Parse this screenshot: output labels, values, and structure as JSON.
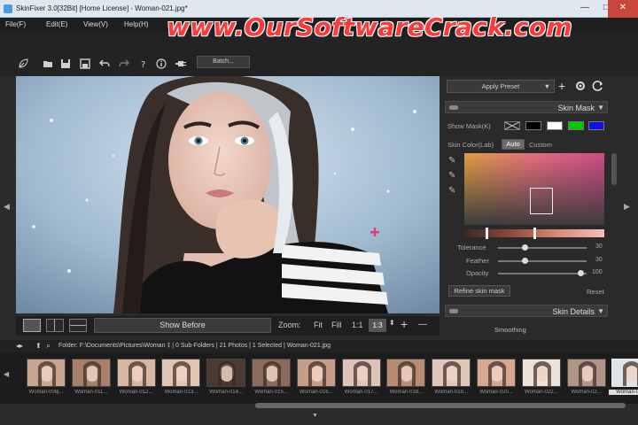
{
  "window": {
    "title": "SkinFixer 3.0[32Bit] [Home License] - Woman-021.jpg*",
    "controls": {
      "minimize": "—",
      "maximize": "□",
      "close": "✕"
    }
  },
  "watermark": "www.OurSoftwareCrack.com",
  "menu": {
    "file": "File(F)",
    "edit": "Edit(E)",
    "view": "View(V)",
    "help": "Help(H)"
  },
  "toolbar": {
    "batch_label": "Batch...",
    "icons": [
      "logo-leaf-icon",
      "open-icon",
      "save-icon",
      "save-as-icon",
      "undo-icon",
      "redo-icon",
      "help-icon",
      "info-icon",
      "plugin-icon"
    ]
  },
  "viewbar": {
    "show_before_label": "Show Before",
    "zoom_label": "Zoom:",
    "fit_label": "Fit",
    "fill_label": "Fill",
    "one_to_one_label": "1:1",
    "zoom_value": "1:3",
    "plus": "+",
    "minus": "—"
  },
  "panel": {
    "apply_preset_label": "Apply Preset",
    "skin_mask": {
      "header": "Skin Mask",
      "show_mask_label": "Show Mask(K)",
      "swatch_colors": [
        "#000000",
        "#ffffff",
        "#00c800",
        "#1010e0"
      ],
      "skin_color_label": "Skin Color(Lab)",
      "auto_label": "Auto",
      "custom_label": "Custom",
      "tolerance_label": "Tolerance",
      "tolerance_value": "30",
      "feather_label": "Feather",
      "feather_value": "30",
      "opacity_label": "Opacity",
      "opacity_value": "100",
      "tolerance_level": 0.3,
      "feather_level": 0.3,
      "opacity_level": 1.0,
      "refine_label": "Refine skin mask",
      "reset_label": "Reset"
    },
    "skin_details": {
      "header": "Skin Details",
      "smoothing_label": "Smoothing"
    }
  },
  "filmbar": {
    "folder_text": "Folder:  F:\\Documents\\Pictures\\Woman ‡ | 0 Sub-Folders | 21 Photos | 1 Selected | Woman-021.jpg"
  },
  "thumbnails": [
    {
      "label": "Woman-008j..."
    },
    {
      "label": "Woman-011..."
    },
    {
      "label": "Woman-012..."
    },
    {
      "label": "Woman-013..."
    },
    {
      "label": "Woman-014..."
    },
    {
      "label": "Woman-015..."
    },
    {
      "label": "Woman-016..."
    },
    {
      "label": "Woman-017..."
    },
    {
      "label": "Woman-018..."
    },
    {
      "label": "Woman-019..."
    },
    {
      "label": "Woman-020..."
    },
    {
      "label": "Woman-022..."
    },
    {
      "label": "Woman-02..."
    },
    {
      "label": "Woman-02..."
    }
  ],
  "colors": {
    "accent_marker": "#e0407a",
    "selected_thumb": "#dedede"
  }
}
